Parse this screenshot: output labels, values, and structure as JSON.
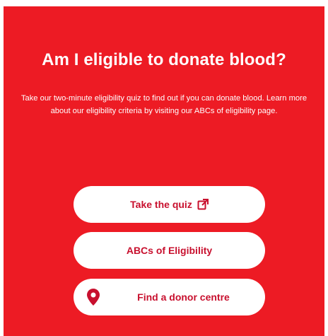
{
  "hero": {
    "title": "Am I eligible to donate blood?",
    "description": "Take our two-minute eligibility quiz to find out if you can donate blood. Learn more about our eligibility criteria by visiting our ABCs of eligibility page."
  },
  "buttons": {
    "quiz_label": "Take the quiz",
    "abcs_label": "ABCs of Eligibility",
    "donor_label": "Find a donor centre"
  },
  "icons": {
    "quiz": "external-link-icon",
    "donor": "map-pin-icon"
  },
  "colors": {
    "brand_red": "#ed1b24",
    "button_text": "#c8102e",
    "button_bg": "#ffffff"
  }
}
